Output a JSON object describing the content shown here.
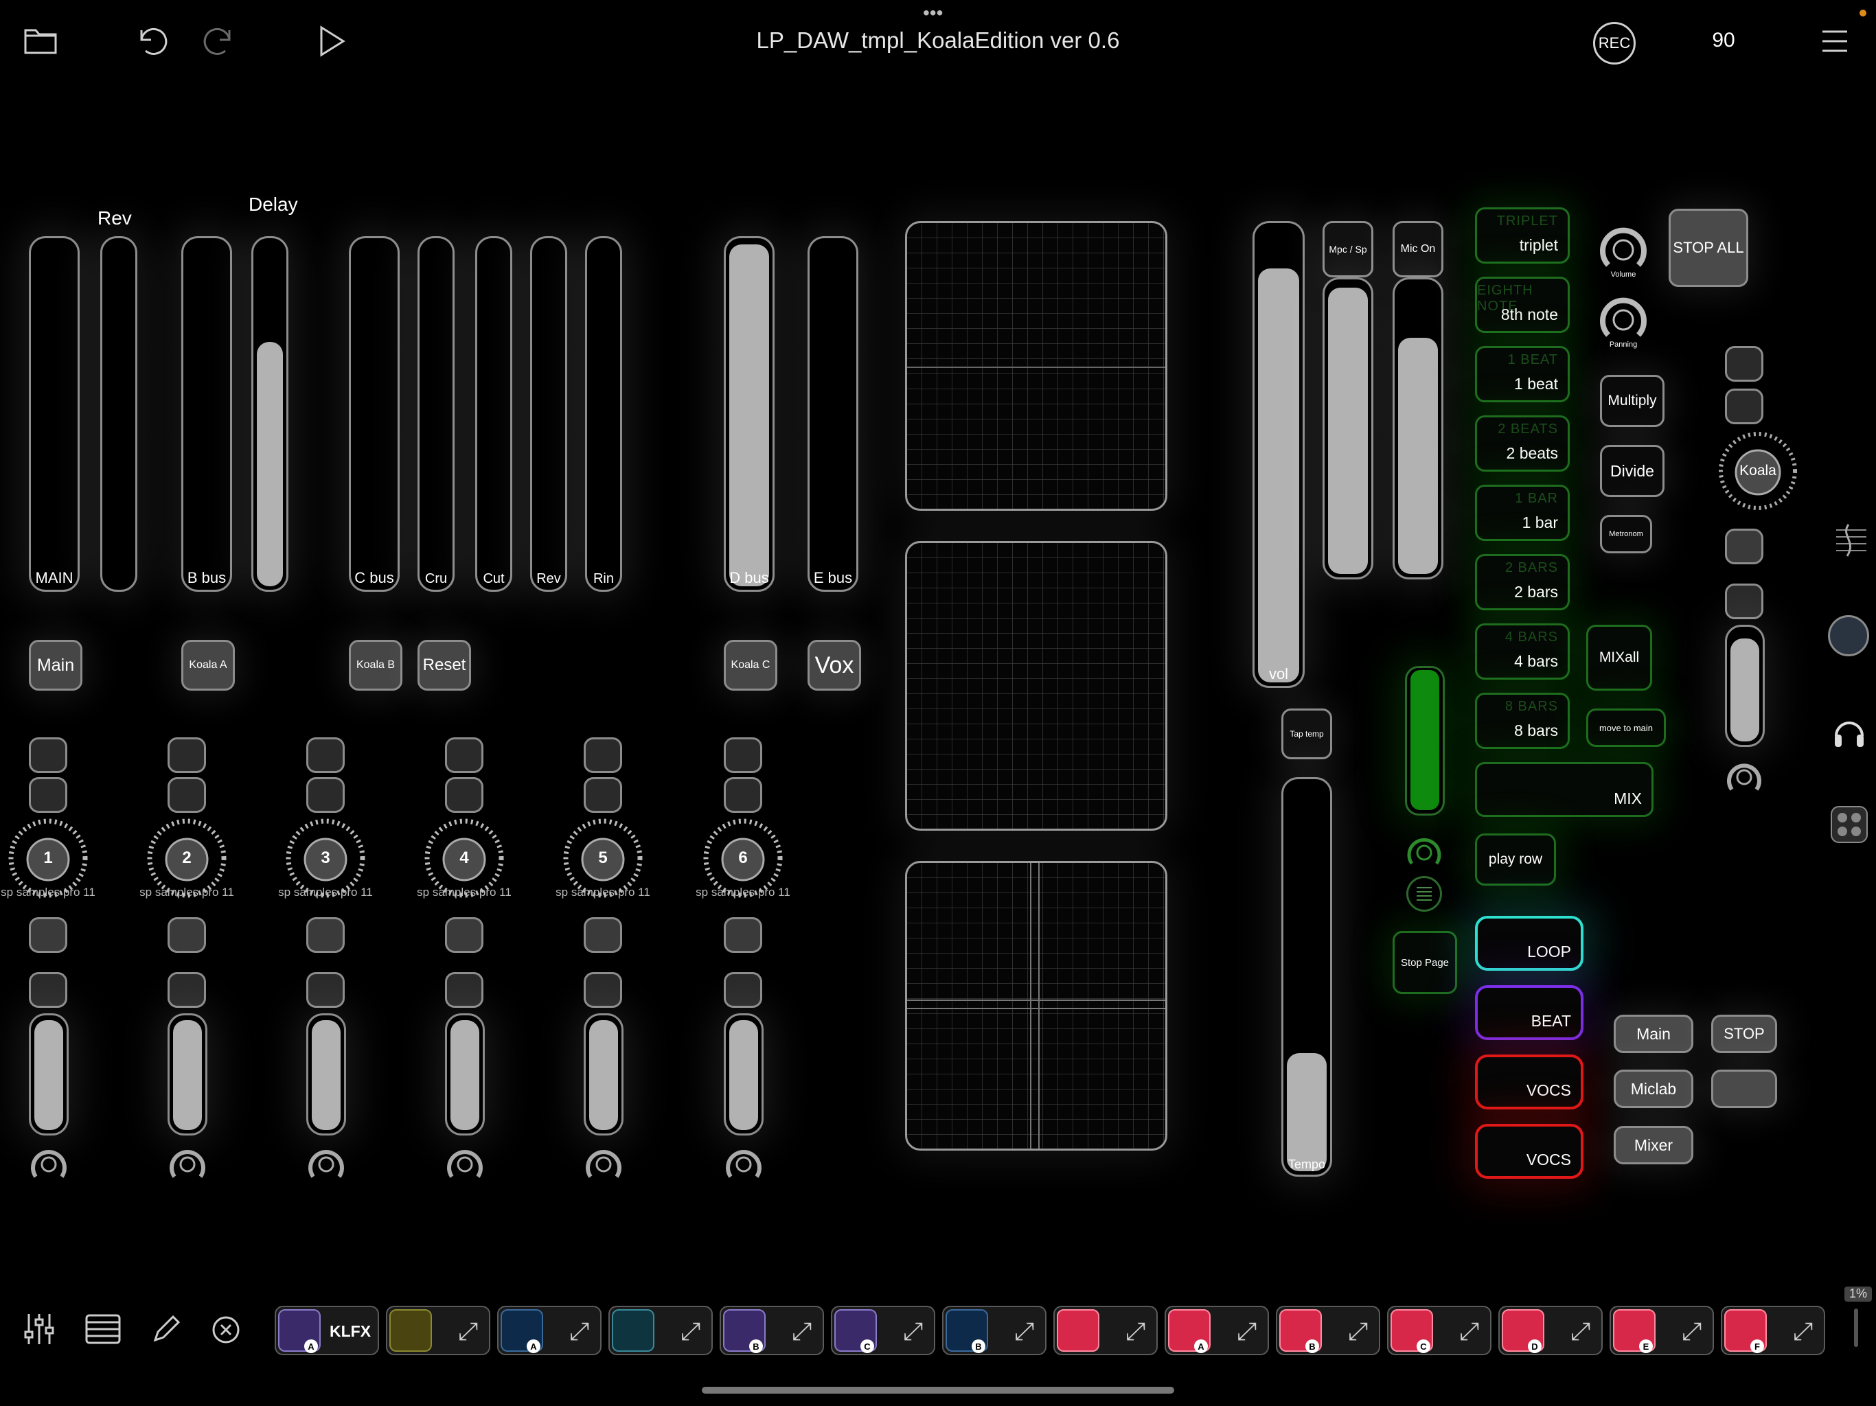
{
  "header": {
    "title": "LP_DAW_tmpl_KoalaEdition ver 0.6",
    "rec_label": "REC",
    "tempo_value": "90",
    "icons": [
      "folder-icon",
      "undo-icon",
      "redo-icon",
      "play-icon",
      "menu-icon"
    ]
  },
  "section_labels": {
    "rev": "Rev",
    "delay": "Delay"
  },
  "faders": [
    {
      "label": "MAIN",
      "level": 0
    },
    {
      "label": "",
      "level": 0
    },
    {
      "label": "B bus",
      "level": 0
    },
    {
      "label": "",
      "level": 0.7
    },
    {
      "label": "C bus",
      "level": 0
    },
    {
      "label": "Cru",
      "level": 0
    },
    {
      "label": "Cut",
      "level": 0
    },
    {
      "label": "Rev",
      "level": 0
    },
    {
      "label": "Rin",
      "level": 0
    },
    {
      "label": "D bus",
      "level": 0.98
    },
    {
      "label": "E bus",
      "level": 0
    }
  ],
  "bus_buttons": [
    "Main",
    "Koala A",
    "Koala B",
    "Reset",
    "Koala C",
    "Vox"
  ],
  "channel_strips": [
    {
      "number": "1",
      "name": "sp samples pro 11",
      "level": 0.95
    },
    {
      "number": "2",
      "name": "sp samples pro 11",
      "level": 0.95
    },
    {
      "number": "3",
      "name": "sp samples pro 11",
      "level": 0.95
    },
    {
      "number": "4",
      "name": "sp samples pro 11",
      "level": 0.95
    },
    {
      "number": "5",
      "name": "sp samples pro 11",
      "level": 0.95
    },
    {
      "number": "6",
      "name": "sp samples pro 11",
      "level": 0.95
    }
  ],
  "master": {
    "vol_label": "vol",
    "vol_level": 0.9,
    "mpc_label": "Mpc / Sp",
    "mpc_level": 0.97,
    "mic_label": "Mic On",
    "mic_level": 0.8,
    "tap_tempo_label": "Tap temp",
    "tempo_label": "Tempo",
    "tempo_level": 0.3,
    "stop_page_label": "Stop Page",
    "green_level": 1.0
  },
  "note_buttons": [
    {
      "ghost": "TRIPLET",
      "label": "triplet"
    },
    {
      "ghost": "EIGHTH NOTE",
      "label": "8th note"
    },
    {
      "ghost": "1 BEAT",
      "label": "1 beat"
    },
    {
      "ghost": "2 BEATS",
      "label": "2 beats"
    },
    {
      "ghost": "1 BAR",
      "label": "1 bar"
    },
    {
      "ghost": "2 BARS",
      "label": "2 bars"
    },
    {
      "ghost": "4 BARS",
      "label": "4 bars"
    },
    {
      "ghost": "8 BARS",
      "label": "8 bars"
    }
  ],
  "loop_controls": {
    "volume_label": "Volume",
    "panning_label": "Panning",
    "multiply_label": "Multiply",
    "divide_label": "Divide",
    "metronome_label": "Metronom",
    "mixall_label": "MIXall",
    "move_to_main_label": "move to main",
    "mix_label": "MIX",
    "play_row_label": "play row",
    "stop_all_label": "STOP ALL"
  },
  "track_buttons": [
    {
      "label": "LOOP",
      "color": "#2ee0d0"
    },
    {
      "label": "BEAT",
      "color": "#7a2ee6"
    },
    {
      "label": "VOCS",
      "color": "#e01818"
    },
    {
      "label": "VOCS",
      "color": "#e01818"
    }
  ],
  "page_buttons": {
    "main": "Main",
    "stop": "STOP",
    "miclab": "Miclab",
    "mixer": "Mixer"
  },
  "koala_knob_label": "Koala",
  "right_rail_icons": [
    "score-icon",
    "speaker-icon",
    "headphones-icon",
    "grid-icon"
  ],
  "dock": {
    "left_icons": [
      "mixer-sliders-icon",
      "list-icon",
      "pencil-icon",
      "close-circle-icon"
    ],
    "klfx_label": "KLFX",
    "cpu": "1%",
    "slots": [
      {
        "icon": "koala-purple-icon",
        "badge": "A",
        "text": "KLFX"
      },
      {
        "icon": "filter-curve-icon",
        "badge": ""
      },
      {
        "icon": "swirl-icon",
        "badge": "A"
      },
      {
        "icon": "vu-meter-icon",
        "badge": ""
      },
      {
        "icon": "koala-purple-icon",
        "badge": "B"
      },
      {
        "icon": "koala-purple-icon",
        "badge": "C"
      },
      {
        "icon": "swirl-icon",
        "badge": "B"
      },
      {
        "icon": "koala-red-icon",
        "badge": ""
      },
      {
        "icon": "koala-red-icon",
        "badge": "A"
      },
      {
        "icon": "koala-red-icon",
        "badge": "B"
      },
      {
        "icon": "koala-red-icon",
        "badge": "C"
      },
      {
        "icon": "koala-red-icon",
        "badge": "D"
      },
      {
        "icon": "koala-red-icon",
        "badge": "E"
      },
      {
        "icon": "koala-red-icon",
        "badge": "F"
      }
    ]
  }
}
